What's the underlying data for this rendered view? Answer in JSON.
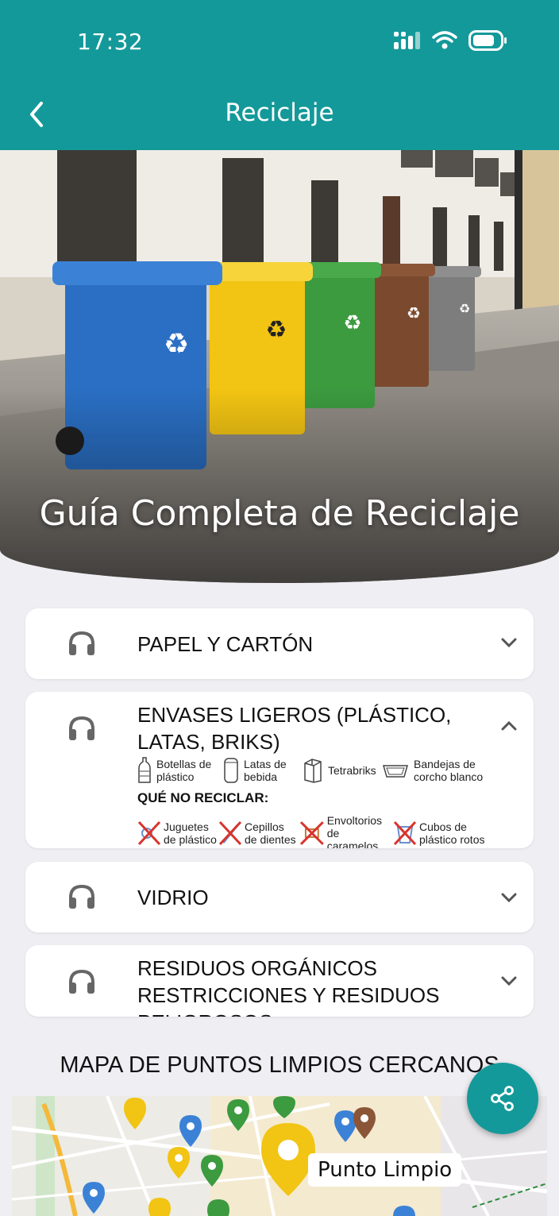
{
  "status_bar": {
    "time": "17:32"
  },
  "header": {
    "title": "Reciclaje"
  },
  "hero": {
    "title": "Guía Completa de Reciclaje"
  },
  "sections": [
    {
      "title": "PAPEL Y CARTÓN",
      "expanded": false
    },
    {
      "title_line1": "ENVASES LIGEROS (PLÁSTICO,",
      "title_line2": "LATAS, BRIKS)",
      "expanded": true,
      "recycle_items": [
        {
          "icon": "bottle-icon",
          "line1": "Botellas de",
          "line2": "plástico"
        },
        {
          "icon": "can-icon",
          "line1": "Latas de",
          "line2": "bebida"
        },
        {
          "icon": "carton-icon",
          "line1": "Tetrabriks",
          "line2": ""
        },
        {
          "icon": "tray-icon",
          "line1": "Bandejas de",
          "line2": "corcho blanco"
        }
      ],
      "no_recycle_title": "QUÉ NO RECICLAR:",
      "no_recycle_items": [
        {
          "icon": "toy-icon",
          "line1": "Juguetes",
          "line2": "de plástico"
        },
        {
          "icon": "toothbrush-icon",
          "line1": "Cepillos",
          "line2": "de dientes"
        },
        {
          "icon": "wrapper-icon",
          "line1": "Envoltorios",
          "line2": "de caramelos"
        },
        {
          "icon": "bucket-icon",
          "line1": "Cubos de",
          "line2": "plástico rotos"
        }
      ]
    },
    {
      "title": "VIDRIO",
      "expanded": false
    },
    {
      "title_line1": "RESIDUOS ORGÁNICOS",
      "title_line2": "RESTRICCIONES Y RESIDUOS",
      "title_line3": "PELIGROSOS",
      "expanded": false
    }
  ],
  "map": {
    "title": "MAPA DE PUNTOS LIMPIOS CERCANOS",
    "marker_label": "Punto Limpio"
  },
  "colors": {
    "accent": "#14999a",
    "bin_blue": "#2a6fc4",
    "bin_yellow": "#f2c413",
    "bin_green": "#3c9a3f",
    "bin_brown": "#7b4a2e",
    "bin_gray": "#7d7d7d"
  }
}
